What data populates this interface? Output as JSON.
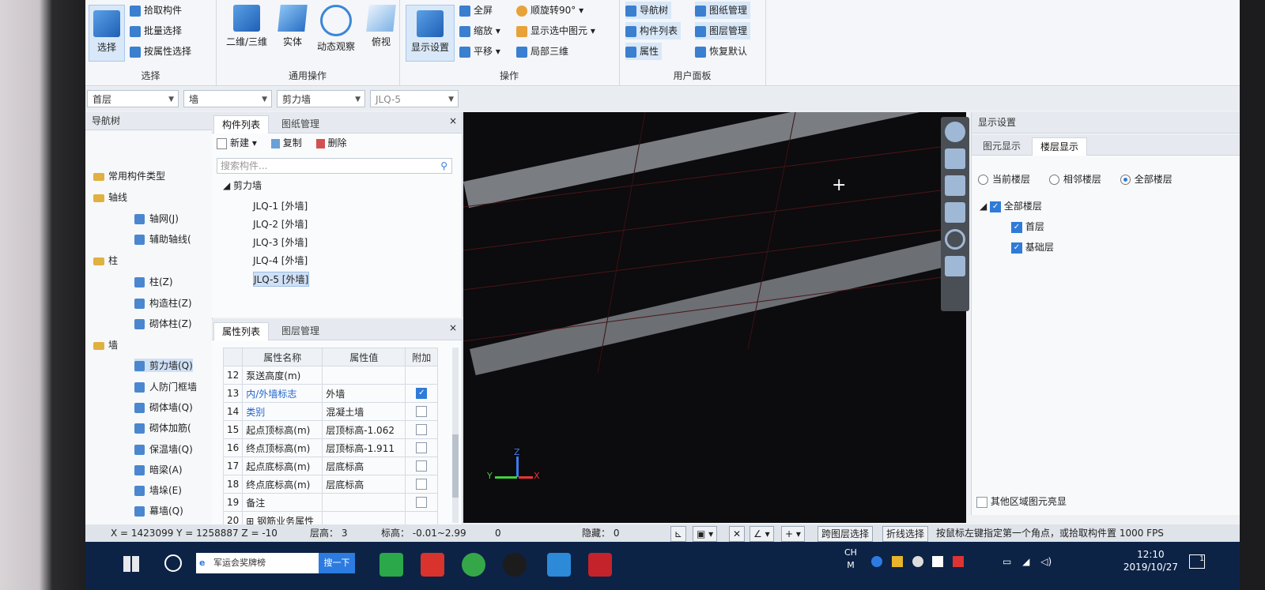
{
  "ribbon": {
    "select_group": {
      "title": "选择",
      "big_label": "选择",
      "items": [
        "拾取构件",
        "批量选择",
        "按属性选择"
      ]
    },
    "common_group": {
      "title": "通用操作",
      "buttons": [
        "二维/三维",
        "实体",
        "动态观察",
        "俯视"
      ]
    },
    "ops_group": {
      "title": "操作",
      "big_label": "显示设置",
      "items": [
        "全屏",
        "缩放",
        "平移",
        "顺旋转90°",
        "显示选中图元",
        "局部三维"
      ]
    },
    "panel_group": {
      "title": "用户面板",
      "items": [
        "导航树",
        "构件列表",
        "属性",
        "图纸管理",
        "图层管理",
        "恢复默认"
      ]
    }
  },
  "combos": [
    "首层",
    "墙",
    "剪力墙",
    "JLQ-5"
  ],
  "nav": {
    "title": "导航树",
    "items": [
      {
        "label": "常用构件类型",
        "type": "folder"
      },
      {
        "label": "轴线",
        "type": "folder"
      },
      {
        "label": "轴网(J)",
        "type": "child"
      },
      {
        "label": "辅助轴线(",
        "type": "child"
      },
      {
        "label": "柱",
        "type": "folder"
      },
      {
        "label": "柱(Z)",
        "type": "child"
      },
      {
        "label": "构造柱(Z)",
        "type": "child"
      },
      {
        "label": "砌体柱(Z)",
        "type": "child"
      },
      {
        "label": "墙",
        "type": "folder"
      },
      {
        "label": "剪力墙(Q)",
        "type": "child"
      },
      {
        "label": "人防门框墙",
        "type": "child"
      },
      {
        "label": "砌体墙(Q)",
        "type": "child"
      },
      {
        "label": "砌体加筋(",
        "type": "child"
      },
      {
        "label": "保温墙(Q)",
        "type": "child"
      },
      {
        "label": "暗梁(A)",
        "type": "child"
      },
      {
        "label": "墙垛(E)",
        "type": "child"
      },
      {
        "label": "幕墙(Q)",
        "type": "child"
      }
    ]
  },
  "comp_list": {
    "tabs": [
      "构件列表",
      "图纸管理"
    ],
    "toolbar": [
      "新建",
      "复制",
      "删除"
    ],
    "search_placeholder": "搜索构件...",
    "root": "剪力墙",
    "items": [
      "JLQ-1 [外墙]",
      "JLQ-2 [外墙]",
      "JLQ-3 [外墙]",
      "JLQ-4 [外墙]",
      "JLQ-5 [外墙]"
    ]
  },
  "prop_list": {
    "tabs": [
      "属性列表",
      "图层管理"
    ],
    "headers": [
      "属性名称",
      "属性值",
      "附加"
    ],
    "rows": [
      {
        "n": "12",
        "name": "泵送高度(m)",
        "value": "",
        "check": false,
        "has_cb": false,
        "blue": false
      },
      {
        "n": "13",
        "name": "内/外墙标志",
        "value": "外墙",
        "check": true,
        "has_cb": true,
        "blue": true
      },
      {
        "n": "14",
        "name": "类别",
        "value": "混凝土墙",
        "check": false,
        "has_cb": true,
        "blue": true
      },
      {
        "n": "15",
        "name": "起点顶标高(m)",
        "value": "层顶标高-1.062",
        "check": false,
        "has_cb": true,
        "blue": false
      },
      {
        "n": "16",
        "name": "终点顶标高(m)",
        "value": "层顶标高-1.911",
        "check": false,
        "has_cb": true,
        "blue": false
      },
      {
        "n": "17",
        "name": "起点底标高(m)",
        "value": "层底标高",
        "check": false,
        "has_cb": true,
        "blue": false
      },
      {
        "n": "18",
        "name": "终点底标高(m)",
        "value": "层底标高",
        "check": false,
        "has_cb": true,
        "blue": false
      },
      {
        "n": "19",
        "name": "备注",
        "value": "",
        "check": false,
        "has_cb": true,
        "blue": false
      },
      {
        "n": "20",
        "name": "钢筋业务属性",
        "value": "",
        "check": false,
        "has_cb": false,
        "blue": false
      }
    ]
  },
  "viewport": {
    "axes": {
      "x": "X",
      "y": "Y",
      "z": "Z"
    },
    "cursor": "+"
  },
  "display": {
    "title": "显示设置",
    "tabs": [
      "图元显示",
      "楼层显示"
    ],
    "radios": [
      "当前楼层",
      "相邻楼层",
      "全部楼层"
    ],
    "tree_root": "全部楼层",
    "floors": [
      "首层",
      "基础层"
    ],
    "bottom_option": "其他区域图元亮显"
  },
  "status": {
    "coords": "X = 1423099 Y = 1258887 Z = -10",
    "floor_h": "层高：  3",
    "elev": "标高：  -0.01~2.99",
    "zero": "0",
    "hidden": "隐藏：  0",
    "btn_cross": "跨图层选择",
    "btn_poly": "折线选择",
    "hint": "按鼠标左键指定第一个角点，或拾取构件置 1000 FPS"
  },
  "taskbar": {
    "search_text": "军运会奖牌榜",
    "search_btn": "搜一下",
    "lang": "CH",
    "ime": "M",
    "time": "12:10",
    "date": "2019/10/27",
    "notif": "1"
  }
}
